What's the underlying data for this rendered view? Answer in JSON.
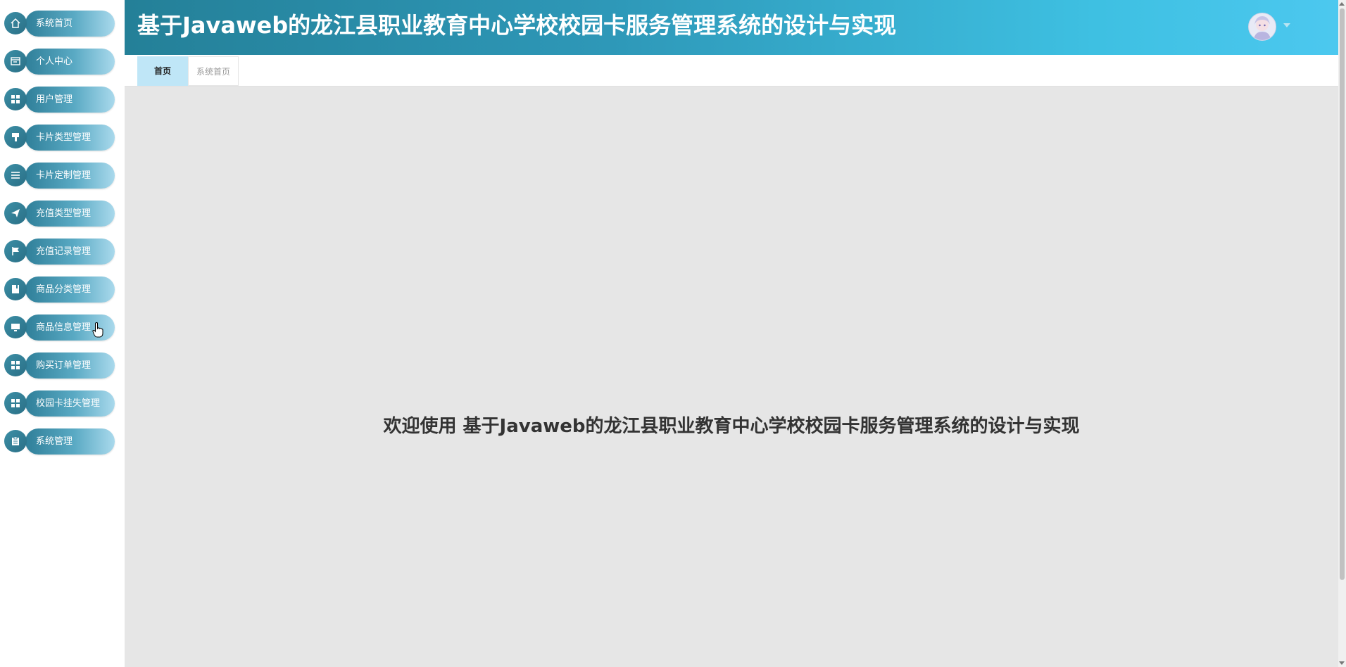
{
  "header": {
    "title": "基于Javaweb的龙江县职业教育中心学校校园卡服务管理系统的设计与实现",
    "avatar_icon": "user-avatar",
    "dropdown_icon": "caret-down-icon"
  },
  "sidebar": {
    "items": [
      {
        "label": "系统首页",
        "icon": "home-icon"
      },
      {
        "label": "个人中心",
        "icon": "profile-card-icon"
      },
      {
        "label": "用户管理",
        "icon": "grid-icon"
      },
      {
        "label": "卡片类型管理",
        "icon": "brush-icon"
      },
      {
        "label": "卡片定制管理",
        "icon": "list-icon"
      },
      {
        "label": "充值类型管理",
        "icon": "paper-plane-icon"
      },
      {
        "label": "充值记录管理",
        "icon": "flag-icon"
      },
      {
        "label": "商品分类管理",
        "icon": "notebook-icon"
      },
      {
        "label": "商品信息管理",
        "icon": "monitor-icon"
      },
      {
        "label": "购买订单管理",
        "icon": "grid-icon"
      },
      {
        "label": "校园卡挂失管理",
        "icon": "grid-icon"
      },
      {
        "label": "系统管理",
        "icon": "clipboard-icon"
      }
    ]
  },
  "tabs": {
    "home": "首页",
    "system_home": "系统首页"
  },
  "main": {
    "welcome": "欢迎使用 基于Javaweb的龙江县职业教育中心学校校园卡服务管理系统的设计与实现"
  },
  "colors": {
    "header_gradient_start": "#248098",
    "header_gradient_end": "#4cc8ef",
    "active_tab": "#bfe6f7",
    "main_bg": "#e6e6e6"
  }
}
